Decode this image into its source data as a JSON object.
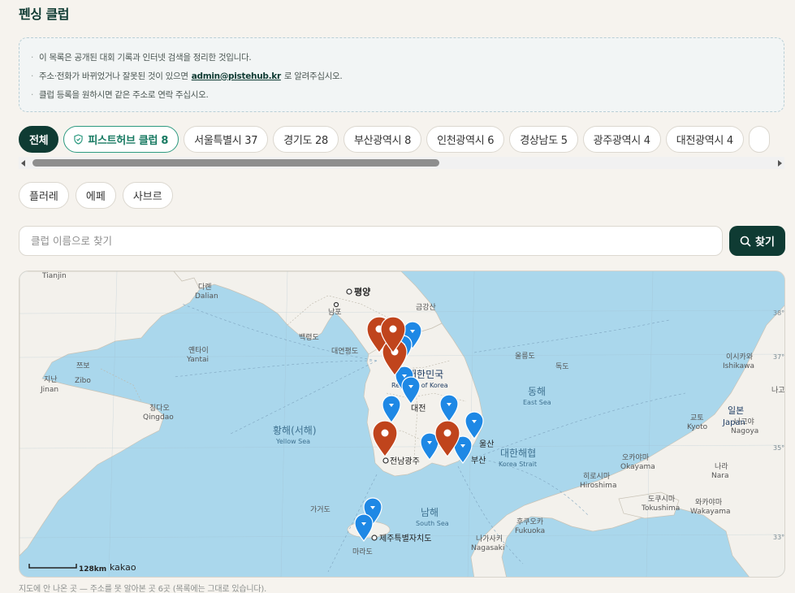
{
  "page": {
    "title": "펜싱 클럽"
  },
  "notice": {
    "line1": "이 목록은 공개된 대회 기록과 인터넷 검색을 정리한 것입니다.",
    "line2_before": "주소·전화가 바뀌었거나 잘못된 것이 있으면",
    "line2_email": "admin@pistehub.kr",
    "line2_after": "로 알려주십시오.",
    "line3": "클럽 등록을 원하시면 같은 주소로 연락 주십시오."
  },
  "region_chips": [
    {
      "label": "전체"
    },
    {
      "label": "피스트허브 클럽 8"
    },
    {
      "label": "서울특별시 37"
    },
    {
      "label": "경기도 28"
    },
    {
      "label": "부산광역시 8"
    },
    {
      "label": "인천광역시 6"
    },
    {
      "label": "경상남도 5"
    },
    {
      "label": "광주광역시 4"
    },
    {
      "label": "대전광역시 4"
    },
    {
      "label": ""
    }
  ],
  "weapon_chips": [
    {
      "label": "플러레"
    },
    {
      "label": "에페"
    },
    {
      "label": "사브르"
    }
  ],
  "search": {
    "placeholder": "클럽 이름으로 찾기",
    "value": "",
    "button_label": "찾기"
  },
  "map": {
    "scale_label": "128km",
    "provider": "kakao",
    "labels": {
      "tianjin": "Tianjin",
      "dalian_ko": "다롄",
      "dalian_en": "Dalian",
      "pyongyang": "평양",
      "nampo": "남포",
      "geumgangsan": "금강산",
      "baengnyeongdo": "백령도",
      "daeyeonpyeongdo": "대연평도",
      "yantai_ko": "옌타이",
      "yantai_en": "Yantai",
      "zibo_ko": "쯔보",
      "zibo_en": "Zibo",
      "jinan_ko": "지난",
      "jinan_en": "Jinan",
      "qingdao_ko": "칭다오",
      "qingdao_en": "Qingdao",
      "korea_ko": "대한민국",
      "korea_en": "Republic of Korea",
      "daejeon": "대전",
      "ulleungdo": "울릉도",
      "dokdo": "독도",
      "eastsea_ko": "동해",
      "eastsea_en": "East Sea",
      "yellowsea_ko": "황해(서해)",
      "yellowsea_en": "Yellow Sea",
      "ulsan": "울산",
      "busan": "부산",
      "koreastrait_ko": "대한해협",
      "koreastrait_en": "Korea Strait",
      "gwangju": "전남광주",
      "namhae_ko": "남해",
      "namhae_en": "South Sea",
      "gageodo": "가거도",
      "jeju": "제주특별자치도",
      "marado": "마라도",
      "ishikawa_ko": "이시카와",
      "ishikawa_en": "Ishikawa",
      "japan_ko": "일본",
      "japan_en": "Japan",
      "naga": "나고",
      "kyoto_ko": "교토",
      "kyoto_en": "Kyoto",
      "nagoya_ko": "나고야",
      "nagoya_en": "Nagoya",
      "okayama_ko": "오카야마",
      "okayama_en": "Okayama",
      "hiroshima_ko": "히로시마",
      "hiroshima_en": "Hiroshima",
      "nara_ko": "나라",
      "nara_en": "Nara",
      "tokushima_ko": "도쿠시마",
      "tokushima_en": "Tokushima",
      "wakayama_ko": "와카야마",
      "wakayama_en": "Wakayama",
      "fukuoka_ko": "후쿠오카",
      "fukuoka_en": "Fukuoka",
      "nagasaki_ko": "나가사키",
      "nagasaki_en": "Nagasaki",
      "lat38": "38°",
      "lat37": "37°",
      "lat35": "35°",
      "lat33": "33°"
    }
  },
  "footer": {
    "note": "지도에 안 나온 곳 — 주소를 못 알아본 곳 6곳 (목록에는 그대로 있습니다)."
  },
  "colors": {
    "primary": "#0f3b33",
    "pistehub": "#2d9a80",
    "pin_blue": "#1e88e5",
    "pin_red": "#c0441c",
    "sea": "#aad7ec",
    "land": "#f3f1ec"
  }
}
